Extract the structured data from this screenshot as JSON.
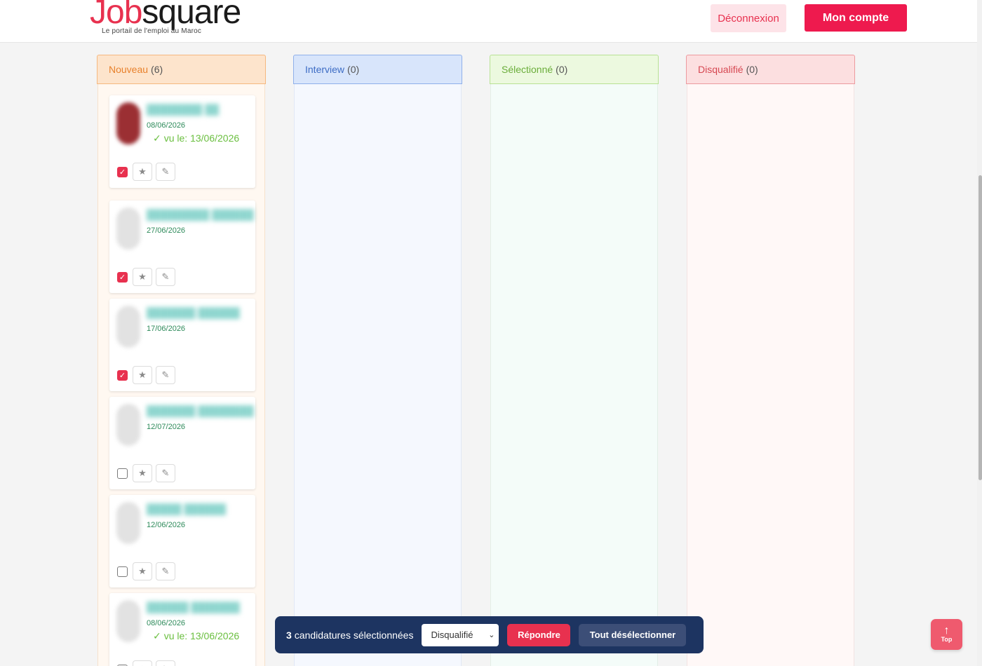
{
  "header": {
    "logo_part1": "Job",
    "logo_part2": "square",
    "tagline": "Le portail de l'emploi au Maroc",
    "logout_label": "Déconnexion",
    "account_label": "Mon compte"
  },
  "columns": [
    {
      "name": "Nouveau",
      "count": "(6)"
    },
    {
      "name": "Interview",
      "count": "(0)"
    },
    {
      "name": "Sélectionné",
      "count": "(0)"
    },
    {
      "name": "Disqualifié",
      "count": "(0)"
    }
  ],
  "candidates": [
    {
      "date": "08/06/2026",
      "seen": "vu le: 13/06/2026",
      "checked": true
    },
    {
      "date": "27/06/2026",
      "seen": "",
      "checked": true
    },
    {
      "date": "17/06/2026",
      "seen": "",
      "checked": true
    },
    {
      "date": "12/07/2026",
      "seen": "",
      "checked": false
    },
    {
      "date": "12/06/2026",
      "seen": "",
      "checked": false
    },
    {
      "date": "08/06/2026",
      "seen": "vu le: 13/06/2026",
      "checked": false
    }
  ],
  "bulk": {
    "count": "3",
    "text": "candidatures sélectionnées",
    "status_selected": "Disqualifié",
    "reply_label": "Répondre",
    "deselect_label": "Tout désélectionner"
  },
  "top_button": {
    "label": "Top"
  },
  "icons": {
    "star": "star-icon",
    "edit": "pencil-icon",
    "check": "check-icon",
    "up": "arrow-up-icon"
  }
}
